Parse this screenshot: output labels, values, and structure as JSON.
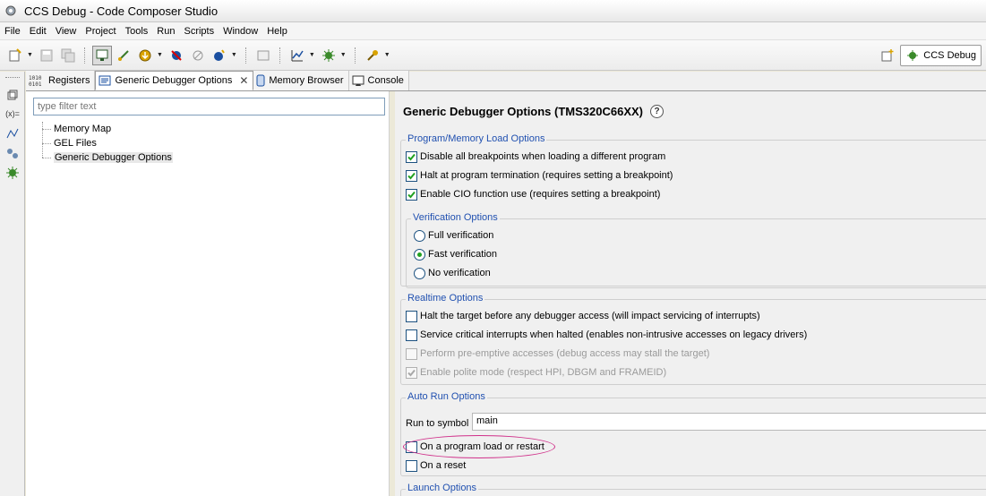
{
  "window": {
    "title": "CCS Debug - Code Composer Studio"
  },
  "menu": [
    "File",
    "Edit",
    "View",
    "Project",
    "Tools",
    "Run",
    "Scripts",
    "Window",
    "Help"
  ],
  "perspective": {
    "label": "CCS Debug"
  },
  "tabs": [
    {
      "label": "Registers",
      "icon": "registers-icon"
    },
    {
      "label": "Generic Debugger Options",
      "icon": "options-icon",
      "active": true
    },
    {
      "label": "Memory Browser",
      "icon": "memory-icon"
    },
    {
      "label": "Console",
      "icon": "console-icon"
    }
  ],
  "left": {
    "filter_placeholder": "type filter text",
    "tree": [
      "Memory Map",
      "GEL Files",
      "Generic Debugger Options"
    ],
    "selected": "Generic Debugger Options"
  },
  "page": {
    "title": "Generic Debugger Options (TMS320C66XX)",
    "program_load": {
      "title": "Program/Memory Load Options",
      "options": [
        {
          "label": "Disable all breakpoints when loading a different program",
          "checked": true
        },
        {
          "label": "Halt at program termination (requires setting a breakpoint)",
          "checked": true
        },
        {
          "label": "Enable CIO function use (requires setting a breakpoint)",
          "checked": true
        }
      ],
      "verification": {
        "title": "Verification Options",
        "options": [
          "Full verification",
          "Fast verification",
          "No verification"
        ],
        "selected": "Fast verification"
      }
    },
    "realtime": {
      "title": "Realtime Options",
      "options": [
        {
          "label": "Halt the target before any debugger access (will impact servicing of interrupts)",
          "checked": false,
          "enabled": true
        },
        {
          "label": "Service critical interrupts when halted (enables non-intrusive accesses on legacy drivers)",
          "checked": false,
          "enabled": true
        },
        {
          "label": "Perform pre-emptive accesses (debug access may stall the target)",
          "checked": false,
          "enabled": false
        },
        {
          "label": "Enable polite mode (respect HPI, DBGM and FRAMEID)",
          "checked": true,
          "enabled": false
        }
      ]
    },
    "auto_run": {
      "title": "Auto Run Options",
      "run_to_symbol_label": "Run to symbol",
      "run_to_symbol_value": "main",
      "options": [
        {
          "label": "On a program load or restart",
          "checked": false
        },
        {
          "label": "On a reset",
          "checked": false
        }
      ]
    },
    "launch": {
      "title": "Launch Options"
    }
  },
  "colors": {
    "group_title": "#2050b0",
    "highlight": "#d0308a",
    "radio_dot": "#21a121"
  }
}
